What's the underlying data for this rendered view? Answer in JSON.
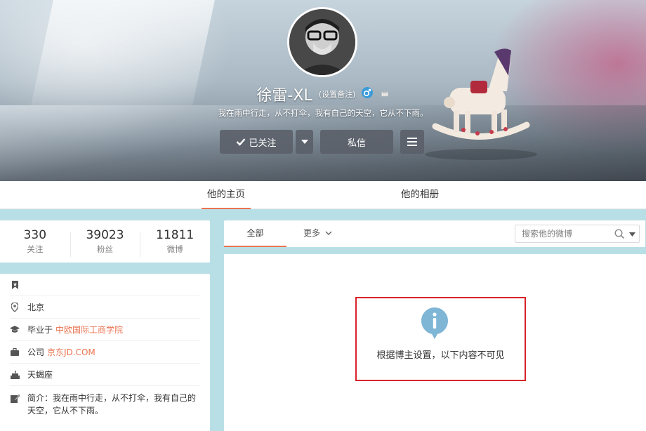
{
  "profile": {
    "name": "徐雷-XL",
    "remark": "(设置备注)",
    "bio": "我在雨中行走，从不打伞，我有自己的天空，它从不下雨。",
    "gender_icon": "male-icon",
    "vip_icon": "crown-icon"
  },
  "actions": {
    "follow_label": "已关注",
    "message_label": "私信"
  },
  "tabs": {
    "home": "他的主页",
    "album": "他的相册"
  },
  "stats": [
    {
      "value": "330",
      "label": "关注"
    },
    {
      "value": "39023",
      "label": "粉丝"
    },
    {
      "value": "11811",
      "label": "微博"
    }
  ],
  "info": {
    "location": "北京",
    "school_prefix": "毕业于",
    "school": "中欧国际工商学院",
    "company_prefix": "公司",
    "company": "京东JD.COM",
    "constellation": "天蝎座",
    "intro": "简介：我在雨中行走，从不打伞，我有自己的天空，它从不下雨。"
  },
  "feed": {
    "tab_all": "全部",
    "tab_more": "更多",
    "search_placeholder": "搜索他的微博",
    "notice": "根据博主设置，以下内容不可见"
  },
  "colors": {
    "accent": "#eb7350",
    "page_bg": "#b9dfe6",
    "highlight_border": "#d8232a",
    "info_icon": "#7fb6d6"
  }
}
